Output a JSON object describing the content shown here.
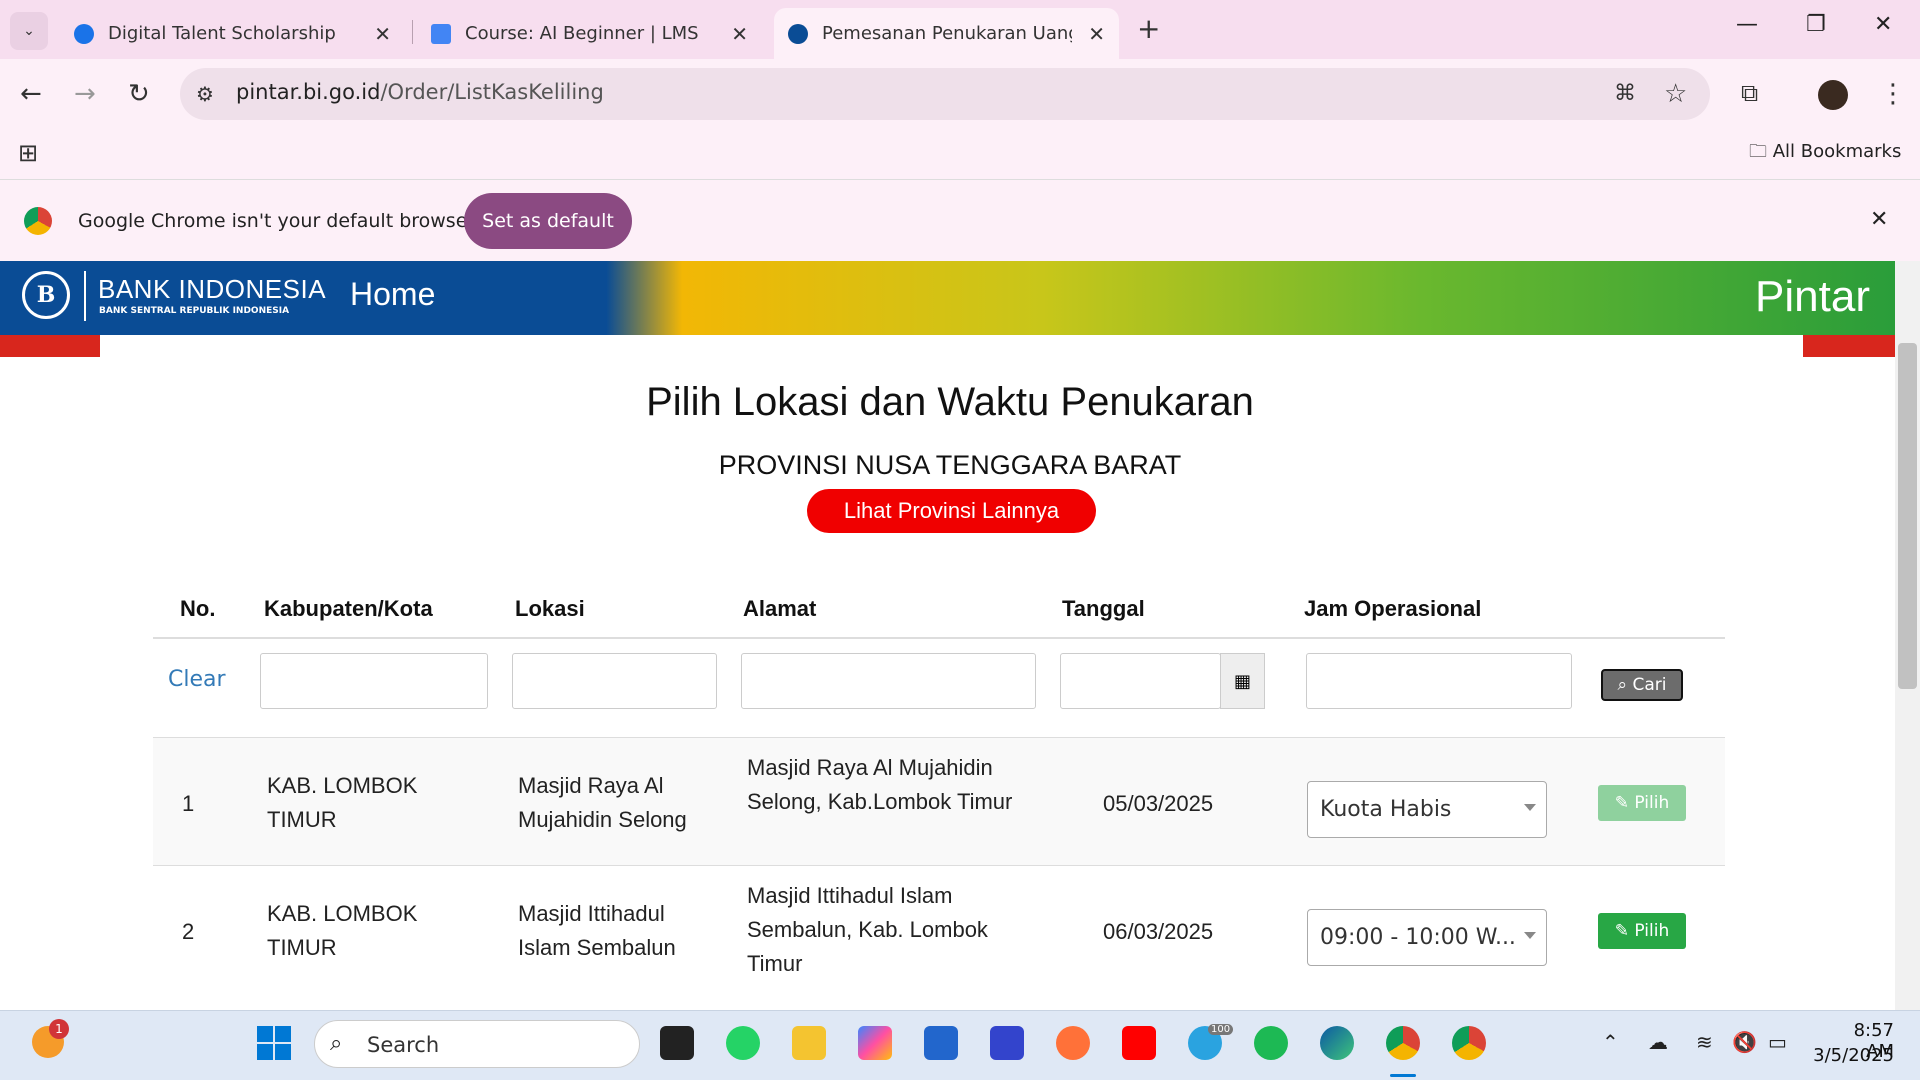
{
  "browser": {
    "tabs": [
      {
        "title": "Digital Talent Scholarship",
        "active": false
      },
      {
        "title": "Course: AI Beginner | LMS",
        "active": false
      },
      {
        "title": "Pemesanan Penukaran Uang Ka",
        "active": true
      }
    ],
    "url_host": "pintar.bi.go.id",
    "url_path": "/Order/ListKasKeliling",
    "bookmarks_label": "All Bookmarks",
    "default_banner_text": "Google Chrome isn't your default browser",
    "set_default_label": "Set as default"
  },
  "site": {
    "logo_name": "BANK INDONESIA",
    "logo_sub": "BANK SENTRAL REPUBLIK INDONESIA",
    "nav_home": "Home",
    "brand": "Pintar"
  },
  "page": {
    "title": "Pilih Lokasi dan Waktu Penukaran",
    "province": "PROVINSI NUSA TENGGARA BARAT",
    "other_province_btn": "Lihat Provinsi Lainnya"
  },
  "table": {
    "headers": [
      "No.",
      "Kabupaten/Kota",
      "Lokasi",
      "Alamat",
      "Tanggal",
      "Jam Operasional"
    ],
    "clear_label": "Clear",
    "search_label": "Cari",
    "rows": [
      {
        "no": "1",
        "kabupaten": "KAB. LOMBOK TIMUR",
        "lokasi": "Masjid Raya Al Mujahidin Selong",
        "alamat": "Masjid Raya Al Mujahidin Selong, Kab.Lombok Timur",
        "tanggal": "05/03/2025",
        "jam": "Kuota Habis",
        "pilih": "Pilih",
        "pilih_enabled": false
      },
      {
        "no": "2",
        "kabupaten": "KAB. LOMBOK TIMUR",
        "lokasi": "Masjid Ittihadul Islam Sembalun",
        "alamat": "Masjid Ittihadul Islam Sembalun, Kab. Lombok Timur",
        "tanggal": "06/03/2025",
        "jam": "09:00 - 10:00 W...",
        "pilih": "Pilih",
        "pilih_enabled": true
      }
    ]
  },
  "taskbar": {
    "search_placeholder": "Search",
    "time": "8:57 AM",
    "date": "3/5/2025",
    "notification_badge": "1",
    "telegram_badge": "100"
  }
}
